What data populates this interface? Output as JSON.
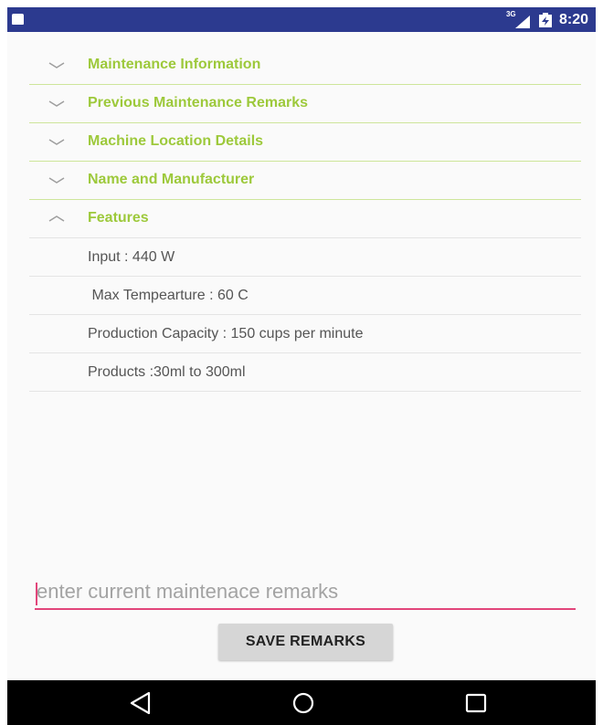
{
  "status_bar": {
    "network": "3G",
    "time": "8:20",
    "icons": [
      "sd-card-icon",
      "signal-icon",
      "battery-charging-icon"
    ]
  },
  "accordion": {
    "sections": [
      {
        "title": "Maintenance Information",
        "expanded": false,
        "icon": "chevron-down-icon"
      },
      {
        "title": "Previous Maintenance Remarks",
        "expanded": false,
        "icon": "chevron-down-icon"
      },
      {
        "title": "Machine Location Details",
        "expanded": false,
        "icon": "chevron-down-icon"
      },
      {
        "title": "Name and Manufacturer",
        "expanded": false,
        "icon": "chevron-down-icon"
      },
      {
        "title": "Features",
        "expanded": true,
        "icon": "chevron-up-icon"
      }
    ],
    "features_items": [
      "Input : 440 W",
      " Max Tempearture : 60 C",
      "Production Capacity : 150 cups per minute",
      "Products :30ml to 300ml"
    ]
  },
  "remarks": {
    "placeholder": "enter current maintenace remarks",
    "value": ""
  },
  "save_button": {
    "label": "SAVE REMARKS"
  },
  "nav_bar": {
    "buttons": [
      "back-icon",
      "home-icon",
      "recents-icon"
    ]
  },
  "colors": {
    "status_bar": "#2c3a8f",
    "accent_green": "#9dc93b",
    "divider_green": "#cde59a",
    "input_underline": "#e2457a",
    "button_bg": "#d6d6d6",
    "nav_bar": "#000000"
  }
}
